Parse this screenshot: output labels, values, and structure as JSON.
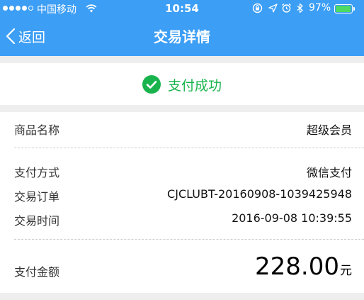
{
  "status_bar": {
    "carrier": "中国移动",
    "time": "10:54",
    "battery_percent": "97%",
    "battery_level": 0.97,
    "icons": [
      "wifi-icon",
      "orientation-lock-icon",
      "location-arrow-icon",
      "alarm-icon",
      "bluetooth-icon",
      "battery-icon"
    ]
  },
  "nav": {
    "back_label": "返回",
    "title": "交易详情"
  },
  "payment_status": {
    "text": "支付成功",
    "icon": "check-circle-icon"
  },
  "details": {
    "product_name": {
      "label": "商品名称",
      "value": "超级会员"
    },
    "payment_method": {
      "label": "支付方式",
      "value": "微信支付"
    },
    "order_number": {
      "label": "交易订单",
      "value": "CJCLUBT-20160908-1039425948"
    },
    "trade_time": {
      "label": "交易时间",
      "value": "2016-09-08 10:39:55"
    },
    "amount": {
      "label": "支付金额",
      "value": "228.00",
      "unit": "元"
    }
  },
  "colors": {
    "header_blue": "#3c9ef5",
    "success_green": "#19b34d",
    "separator_gray": "#eeeeee"
  }
}
